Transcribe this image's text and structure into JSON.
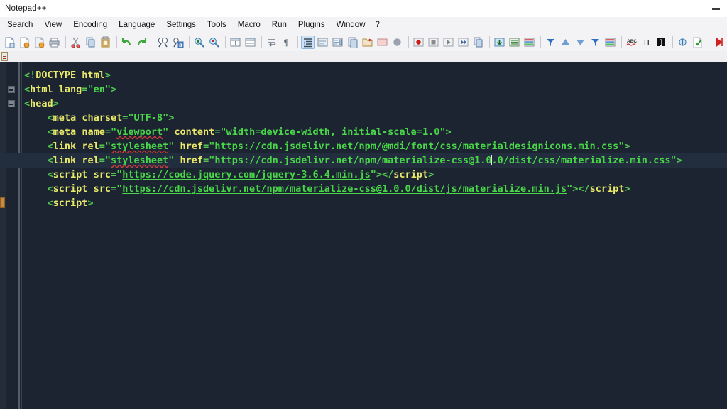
{
  "window": {
    "title": "Notepad++",
    "controls": [
      {
        "name": "minimize",
        "glyph": "—"
      }
    ]
  },
  "menubar": {
    "items": [
      {
        "label": "Search",
        "mnemonic": "S"
      },
      {
        "label": "View",
        "mnemonic": "V"
      },
      {
        "label": "Encoding",
        "mnemonic": "n"
      },
      {
        "label": "Language",
        "mnemonic": "L"
      },
      {
        "label": "Settings",
        "mnemonic": "t"
      },
      {
        "label": "Tools",
        "mnemonic": "o"
      },
      {
        "label": "Macro",
        "mnemonic": "M"
      },
      {
        "label": "Run",
        "mnemonic": "R"
      },
      {
        "label": "Plugins",
        "mnemonic": "P"
      },
      {
        "label": "Window",
        "mnemonic": "W"
      },
      {
        "label": "?",
        "mnemonic": "?"
      }
    ]
  },
  "toolbar": {
    "buttons": [
      {
        "name": "new-file-icon",
        "title": "New"
      },
      {
        "name": "open-file-icon",
        "title": "Open"
      },
      {
        "name": "save-file-icon",
        "title": "Save"
      },
      {
        "name": "print-icon",
        "title": "Print"
      },
      {
        "name": "cut-icon",
        "title": "Cut"
      },
      {
        "name": "copy-icon",
        "title": "Copy"
      },
      {
        "name": "paste-icon",
        "title": "Paste"
      },
      {
        "name": "undo-icon",
        "title": "Undo"
      },
      {
        "name": "redo-icon",
        "title": "Redo"
      },
      {
        "name": "find-icon",
        "title": "Find"
      },
      {
        "name": "replace-icon",
        "title": "Replace"
      },
      {
        "name": "zoom-in-icon",
        "title": "Zoom In"
      },
      {
        "name": "zoom-out-icon",
        "title": "Zoom Out"
      },
      {
        "name": "sync-vertical-icon",
        "title": "Synchronize Vertical Scrolling"
      },
      {
        "name": "sync-horizontal-icon",
        "title": "Synchronize Horizontal Scrolling"
      },
      {
        "name": "word-wrap-icon",
        "title": "Word wrap"
      },
      {
        "name": "show-all-chars-icon",
        "title": "Show All Characters"
      },
      {
        "name": "indent-guide-icon",
        "title": "Show Indent Guide",
        "active": true
      },
      {
        "name": "user-defined-dialog-icon",
        "title": "User-Defined Dialogue"
      },
      {
        "name": "document-map-icon",
        "title": "Document Map"
      },
      {
        "name": "function-list-icon",
        "title": "Function List"
      },
      {
        "name": "folder-workspace-icon",
        "title": "Folder as Workspace"
      },
      {
        "name": "monitoring-icon",
        "title": "Monitoring"
      },
      {
        "name": "dark-mode-icon",
        "title": "Dark Mode"
      },
      {
        "name": "record-macro-icon",
        "title": "Start Recording"
      },
      {
        "name": "stop-macro-icon",
        "title": "Stop Recording"
      },
      {
        "name": "play-macro-icon",
        "title": "Playback"
      },
      {
        "name": "run-macro-multiple-icon",
        "title": "Run a Macro Multiple Times"
      },
      {
        "name": "save-macro-icon",
        "title": "Save Current Recorded Macro"
      },
      {
        "name": "run-icon",
        "title": "Run"
      },
      {
        "name": "tab-settings-icon",
        "title": "Preferences"
      },
      {
        "name": "tab-color-icon",
        "title": "Tab colour"
      },
      {
        "name": "sort-icon",
        "title": "Sort"
      },
      {
        "name": "move-up-icon",
        "title": "Move Up"
      },
      {
        "name": "move-down-icon",
        "title": "Move Down"
      },
      {
        "name": "sort-descending-icon",
        "title": "Sort Descending"
      },
      {
        "name": "column-editor-icon",
        "title": "Column Editor"
      },
      {
        "name": "spell-check-icon",
        "title": "Spell Check"
      },
      {
        "name": "hex-editor-icon",
        "title": "H"
      },
      {
        "name": "console-icon",
        "title": "Console"
      },
      {
        "name": "compare-icon",
        "title": "Compare"
      },
      {
        "name": "check-icon",
        "title": "Check"
      },
      {
        "name": "first-change-icon",
        "title": "First change"
      },
      {
        "name": "previous-change-icon",
        "title": "Previous change"
      },
      {
        "name": "next-change-icon",
        "title": "Next change"
      },
      {
        "name": "last-change-icon",
        "title": "Last change"
      },
      {
        "name": "add-marker-icon",
        "title": "Add marker"
      },
      {
        "name": "clear-marker-icon",
        "title": "Clear marker"
      },
      {
        "name": "next-marker-icon",
        "title": "Next marker"
      }
    ]
  },
  "tabbar": {
    "tabs": [
      {
        "name": "document-tab",
        "label": ""
      }
    ]
  },
  "editor": {
    "current_line_index": 6,
    "caret": {
      "line_index": 6,
      "after_text": "materialize-css@1.0"
    },
    "colors": {
      "background": "#1b2430",
      "current_line": "#222e3e",
      "tag": "#e8e86a",
      "string": "#49d649",
      "punctuation": "#53c853",
      "spell_error": "#d63b3b",
      "marker": "#c98a3e"
    },
    "lines": [
      {
        "indent": 0,
        "fold": false,
        "marker": false,
        "tokens": [
          {
            "type": "punc",
            "text": "<!"
          },
          {
            "type": "doctype",
            "text": "DOCTYPE html"
          },
          {
            "type": "punc",
            "text": ">"
          }
        ]
      },
      {
        "indent": 0,
        "fold": true,
        "marker": false,
        "tokens": [
          {
            "type": "punc",
            "text": "<"
          },
          {
            "type": "tag",
            "text": "html"
          },
          {
            "type": "plain",
            "text": " "
          },
          {
            "type": "attr",
            "text": "lang"
          },
          {
            "type": "punc",
            "text": "="
          },
          {
            "type": "str",
            "text": "\"en\""
          },
          {
            "type": "punc",
            "text": ">"
          }
        ]
      },
      {
        "indent": 0,
        "fold": true,
        "marker": false,
        "tokens": [
          {
            "type": "punc",
            "text": "<"
          },
          {
            "type": "tag",
            "text": "head"
          },
          {
            "type": "punc",
            "text": ">"
          }
        ]
      },
      {
        "indent": 1,
        "fold": false,
        "marker": false,
        "tokens": [
          {
            "type": "punc",
            "text": "<"
          },
          {
            "type": "tag",
            "text": "meta"
          },
          {
            "type": "plain",
            "text": " "
          },
          {
            "type": "attr",
            "text": "charset"
          },
          {
            "type": "punc",
            "text": "="
          },
          {
            "type": "str",
            "text": "\"UTF-8\""
          },
          {
            "type": "punc",
            "text": ">"
          }
        ]
      },
      {
        "indent": 1,
        "fold": false,
        "marker": false,
        "tokens": [
          {
            "type": "punc",
            "text": "<"
          },
          {
            "type": "tag",
            "text": "meta"
          },
          {
            "type": "plain",
            "text": " "
          },
          {
            "type": "attr",
            "text": "name"
          },
          {
            "type": "punc",
            "text": "="
          },
          {
            "type": "str",
            "text": "\""
          },
          {
            "type": "str-sq",
            "text": "viewport"
          },
          {
            "type": "str",
            "text": "\""
          },
          {
            "type": "plain",
            "text": " "
          },
          {
            "type": "attr",
            "text": "content"
          },
          {
            "type": "punc",
            "text": "="
          },
          {
            "type": "str",
            "text": "\"width=device-width, initial-scale=1.0\""
          },
          {
            "type": "punc",
            "text": ">"
          }
        ]
      },
      {
        "indent": 1,
        "fold": false,
        "marker": false,
        "tokens": [
          {
            "type": "punc",
            "text": "<"
          },
          {
            "type": "tag",
            "text": "link"
          },
          {
            "type": "plain",
            "text": " "
          },
          {
            "type": "attr",
            "text": "rel"
          },
          {
            "type": "punc",
            "text": "="
          },
          {
            "type": "str",
            "text": "\""
          },
          {
            "type": "str-sq",
            "text": "stylesheet"
          },
          {
            "type": "str",
            "text": "\""
          },
          {
            "type": "plain",
            "text": " "
          },
          {
            "type": "attr",
            "text": "href"
          },
          {
            "type": "punc",
            "text": "="
          },
          {
            "type": "str",
            "text": "\""
          },
          {
            "type": "url",
            "text": "https://cdn.jsdelivr.net/npm/@mdi/font/css/materialdesignicons.min.css"
          },
          {
            "type": "str",
            "text": "\""
          },
          {
            "type": "punc",
            "text": ">"
          }
        ]
      },
      {
        "indent": 1,
        "fold": false,
        "marker": false,
        "current": true,
        "tokens": [
          {
            "type": "punc",
            "text": "<"
          },
          {
            "type": "tag",
            "text": "link"
          },
          {
            "type": "plain",
            "text": " "
          },
          {
            "type": "attr",
            "text": "rel"
          },
          {
            "type": "punc",
            "text": "="
          },
          {
            "type": "str",
            "text": "\""
          },
          {
            "type": "str-sq",
            "text": "stylesheet"
          },
          {
            "type": "str",
            "text": "\""
          },
          {
            "type": "plain",
            "text": " "
          },
          {
            "type": "attr",
            "text": "href"
          },
          {
            "type": "punc",
            "text": "="
          },
          {
            "type": "str",
            "text": "\""
          },
          {
            "type": "url",
            "text": "https://cdn.jsdelivr.net/npm/materialize-css@1.0"
          },
          {
            "type": "caret",
            "text": ""
          },
          {
            "type": "url",
            "text": ".0/dist/css/materialize.min."
          },
          {
            "type": "url",
            "text": "css"
          },
          {
            "type": "str",
            "text": "\""
          },
          {
            "type": "punc",
            "text": ">"
          }
        ]
      },
      {
        "indent": 1,
        "fold": false,
        "marker": false,
        "tokens": [
          {
            "type": "punc",
            "text": "<"
          },
          {
            "type": "tag",
            "text": "script"
          },
          {
            "type": "plain",
            "text": " "
          },
          {
            "type": "attr",
            "text": "src"
          },
          {
            "type": "punc",
            "text": "="
          },
          {
            "type": "str",
            "text": "\""
          },
          {
            "type": "url",
            "text": "https://code.jquery.com/jquery-3.6.4.min.js"
          },
          {
            "type": "str",
            "text": "\""
          },
          {
            "type": "punc",
            "text": ">"
          },
          {
            "type": "punc",
            "text": "</"
          },
          {
            "type": "tag",
            "text": "script"
          },
          {
            "type": "punc",
            "text": ">"
          }
        ]
      },
      {
        "indent": 1,
        "fold": false,
        "marker": false,
        "tokens": [
          {
            "type": "punc",
            "text": "<"
          },
          {
            "type": "tag",
            "text": "script"
          },
          {
            "type": "plain",
            "text": " "
          },
          {
            "type": "attr",
            "text": "src"
          },
          {
            "type": "punc",
            "text": "="
          },
          {
            "type": "str",
            "text": "\""
          },
          {
            "type": "url",
            "text": "https://cdn.jsdelivr.net/npm/materialize-css@1.0.0/dist/js/materialize.min.js"
          },
          {
            "type": "str",
            "text": "\""
          },
          {
            "type": "punc",
            "text": ">"
          },
          {
            "type": "punc",
            "text": "</"
          },
          {
            "type": "tag",
            "text": "script"
          },
          {
            "type": "punc",
            "text": ">"
          }
        ]
      },
      {
        "indent": 1,
        "fold": false,
        "marker": true,
        "tokens": [
          {
            "type": "punc",
            "text": "<"
          },
          {
            "type": "tag",
            "text": "script"
          },
          {
            "type": "punc",
            "text": ">"
          }
        ]
      }
    ]
  }
}
